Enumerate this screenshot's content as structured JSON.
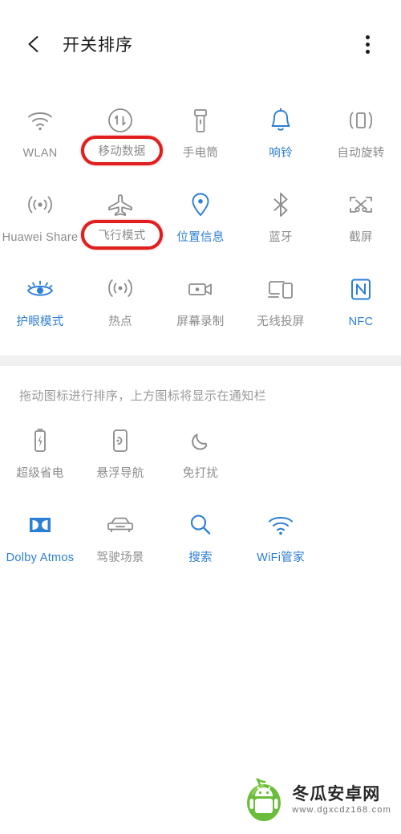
{
  "header": {
    "back_icon": "back-arrow-icon",
    "title": "开关排序",
    "menu_icon": "more-vertical-icon"
  },
  "top_grid": {
    "columns": 5,
    "items": [
      {
        "label": "WLAN",
        "icon": "wifi-icon",
        "state": "off",
        "highlighted": false
      },
      {
        "label": "移动数据",
        "icon": "mobile-data-icon",
        "state": "off",
        "highlighted": true
      },
      {
        "label": "手电筒",
        "icon": "flashlight-icon",
        "state": "off",
        "highlighted": false
      },
      {
        "label": "响铃",
        "icon": "bell-icon",
        "state": "on",
        "highlighted": false
      },
      {
        "label": "自动旋转",
        "icon": "auto-rotate-icon",
        "state": "off",
        "highlighted": false
      },
      {
        "label": "Huawei Share",
        "icon": "huawei-share-icon",
        "state": "off",
        "highlighted": false
      },
      {
        "label": "飞行模式",
        "icon": "airplane-icon",
        "state": "off",
        "highlighted": true
      },
      {
        "label": "位置信息",
        "icon": "location-pin-icon",
        "state": "on",
        "highlighted": false
      },
      {
        "label": "蓝牙",
        "icon": "bluetooth-icon",
        "state": "off",
        "highlighted": false
      },
      {
        "label": "截屏",
        "icon": "screenshot-icon",
        "state": "off",
        "highlighted": false
      },
      {
        "label": "护眼模式",
        "icon": "eye-comfort-icon",
        "state": "on",
        "highlighted": false
      },
      {
        "label": "热点",
        "icon": "hotspot-icon",
        "state": "off",
        "highlighted": false
      },
      {
        "label": "屏幕录制",
        "icon": "screen-record-icon",
        "state": "off",
        "highlighted": false
      },
      {
        "label": "无线投屏",
        "icon": "cast-screen-icon",
        "state": "off",
        "highlighted": false
      },
      {
        "label": "NFC",
        "icon": "nfc-icon",
        "state": "on",
        "highlighted": false
      }
    ]
  },
  "hint": "拖动图标进行排序，上方图标将显示在通知栏",
  "bottom_grid": {
    "columns": 5,
    "items": [
      {
        "label": "超级省电",
        "icon": "battery-saver-icon",
        "state": "off"
      },
      {
        "label": "悬浮导航",
        "icon": "floating-nav-icon",
        "state": "off"
      },
      {
        "label": "免打扰",
        "icon": "do-not-disturb-icon",
        "state": "off"
      },
      {
        "label": "Dolby Atmos",
        "icon": "dolby-atmos-icon",
        "state": "on"
      },
      {
        "label": "驾驶场景",
        "icon": "driving-mode-icon",
        "state": "off"
      },
      {
        "label": "搜索",
        "icon": "search-icon",
        "state": "on"
      },
      {
        "label": "WiFi管家",
        "icon": "wifi-manager-icon",
        "state": "on"
      }
    ]
  },
  "watermark": {
    "logo": "winter-melon-android-logo",
    "site_name": "冬瓜安卓网",
    "url": "www.dgxcdz168.com"
  },
  "colors": {
    "accent_blue": "#2c7ed6",
    "inactive_gray": "#8c8c8c",
    "highlight_red": "#e01e1e",
    "separator_gray": "#f1f1f1"
  }
}
